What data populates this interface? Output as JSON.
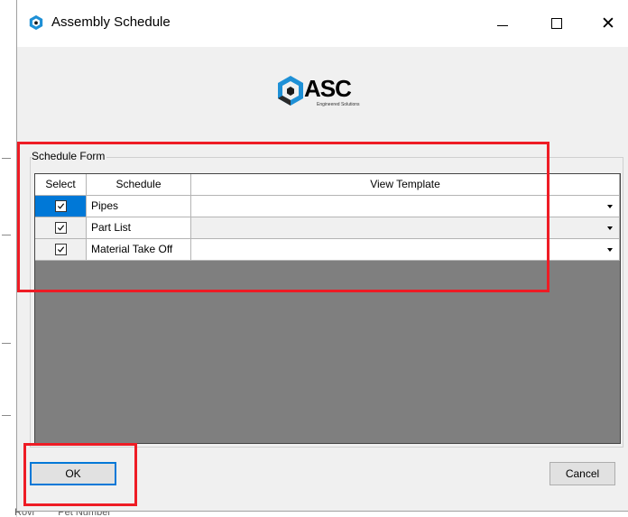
{
  "window": {
    "title": "Assembly Schedule",
    "controls": {
      "minimize_icon": "minimize-icon",
      "maximize_icon": "maximize-icon",
      "close_glyph": "✕"
    }
  },
  "logo": {
    "name": "ASC",
    "tagline": "Engineered Solutions"
  },
  "group": {
    "legend": "Schedule Form"
  },
  "grid": {
    "headers": {
      "select": "Select",
      "schedule": "Schedule",
      "view_template": "View Template"
    },
    "rows": [
      {
        "checked": true,
        "schedule": "Pipes",
        "view_template": ""
      },
      {
        "checked": true,
        "schedule": "Part List",
        "view_template": ""
      },
      {
        "checked": true,
        "schedule": "Material Take Off",
        "view_template": ""
      }
    ]
  },
  "buttons": {
    "ok": "OK",
    "cancel": "Cancel"
  },
  "background": {
    "bottom_fragments": [
      "Rovr",
      "Pet Number"
    ]
  },
  "colors": {
    "accent": "#0078d7",
    "annotation": "#ee1c25",
    "logo_blue": "#1e90d6"
  }
}
